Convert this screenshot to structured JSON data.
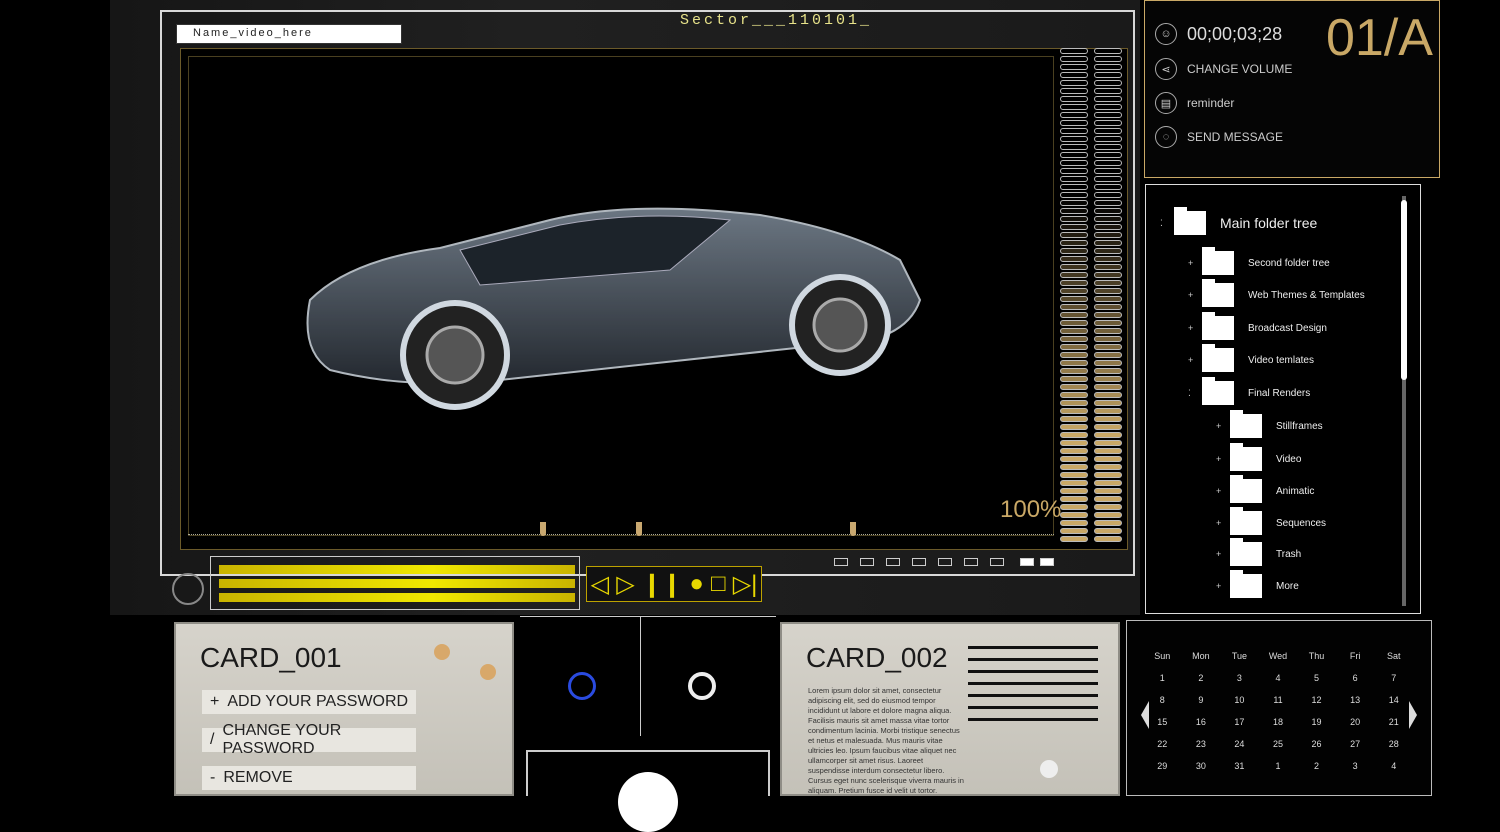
{
  "viewer": {
    "name_field": "Name_video_here",
    "sector": "Sector___110101_",
    "zoom_label": "100%"
  },
  "controls": {
    "prev": "◁",
    "play": "▷",
    "pause": "❙❙",
    "record": "●",
    "stop": "□",
    "next": "▷|"
  },
  "info_panel": {
    "timecode": "00;00;03;28",
    "change_volume": "CHANGE VOLUME",
    "reminder": "reminder",
    "send_message": "SEND MESSAGE",
    "code": "01/A"
  },
  "folder_tree": {
    "root": "Main folder tree",
    "items": [
      "Second folder tree",
      "Web Themes & Templates",
      "Broadcast Design",
      "Video temlates",
      "Final Renders"
    ],
    "sub_items": [
      "Stillframes",
      "Video",
      "Animatic",
      "Sequences",
      "Trash",
      "More"
    ]
  },
  "card1": {
    "title": "CARD_001",
    "add_password": "ADD YOUR PASSWORD",
    "change_password": "CHANGE YOUR PASSWORD",
    "remove": "REMOVE",
    "add_symbol": "+",
    "change_symbol": "/",
    "remove_symbol": "-"
  },
  "card2": {
    "title": "CARD_002",
    "body": "Lorem ipsum dolor sit amet, consectetur adipiscing elit, sed do eiusmod tempor incididunt ut labore et dolore magna aliqua. Facilisis mauris sit amet massa vitae tortor condimentum lacinia. Morbi tristique senectus et netus et malesuada. Mus mauris vitae ultricies leo. Ipsum faucibus vitae aliquet nec ullamcorper sit amet risus. Laoreet suspendisse interdum consectetur libero. Cursus eget nunc scelerisque viverra mauris in aliquam. Pretium fusce id velit ut tortor."
  },
  "calendar": {
    "days": [
      "Sun",
      "Mon",
      "Tue",
      "Wed",
      "Thu",
      "Fri",
      "Sat"
    ],
    "dates": [
      [
        "1",
        "2",
        "3",
        "4",
        "5",
        "6",
        "7"
      ],
      [
        "8",
        "9",
        "10",
        "11",
        "12",
        "13",
        "14"
      ],
      [
        "15",
        "16",
        "17",
        "18",
        "19",
        "20",
        "21"
      ],
      [
        "22",
        "23",
        "24",
        "25",
        "26",
        "27",
        "28"
      ],
      [
        "29",
        "30",
        "31",
        "1",
        "2",
        "3",
        "4"
      ]
    ]
  },
  "colors": {
    "accent_gold": "#c9a866",
    "accent_yellow": "#e8e000"
  }
}
